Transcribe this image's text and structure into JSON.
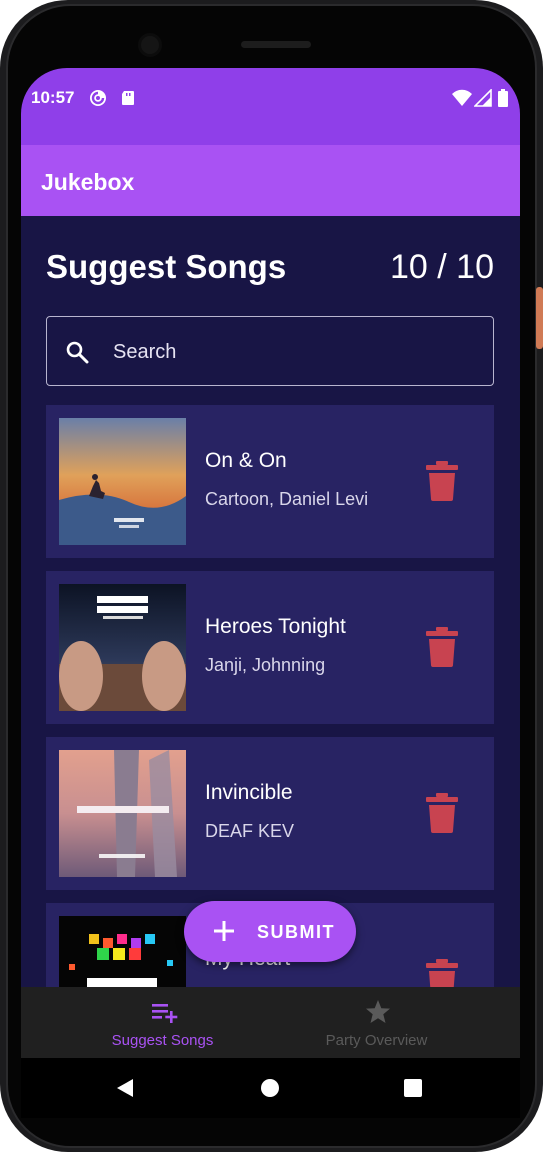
{
  "status_bar": {
    "time": "10:57",
    "icons_left": [
      "sync-icon",
      "sd-card-icon"
    ],
    "icons_right": [
      "wifi-icon",
      "signal-icon",
      "battery-icon"
    ]
  },
  "app_bar": {
    "title": "Jukebox"
  },
  "header": {
    "title": "Suggest Songs",
    "count": "10 / 10"
  },
  "search": {
    "placeholder": "Search",
    "icon": "search-icon"
  },
  "songs": [
    {
      "title": "On & On",
      "artist": "Cartoon, Daniel Levi",
      "cover_text": [
        "cartoon",
        "ON & ON"
      ],
      "action_icon": "trash-icon"
    },
    {
      "title": "Heroes Tonight",
      "artist": "Janji, Johnning",
      "cover_text": [
        "HEROES",
        "TONIGHT",
        "JANJI & JOHNNING"
      ],
      "action_icon": "trash-icon"
    },
    {
      "title": "Invincible",
      "artist": "DEAF KEV",
      "cover_text": [
        "INVINCIBLE",
        "DEAF KEV"
      ],
      "action_icon": "trash-icon"
    },
    {
      "title": "My Heart",
      "artist": "",
      "cover_text": [
        "DIFFERENT HEAVEN & EH!DE",
        "MY HEART"
      ],
      "action_icon": "trash-icon"
    }
  ],
  "fab": {
    "label": "SUBMIT",
    "icon": "plus-icon"
  },
  "bottom_nav": [
    {
      "label": "Suggest Songs",
      "icon": "playlist-add-icon",
      "active": true
    },
    {
      "label": "Party Overview",
      "icon": "star-icon",
      "active": false
    }
  ],
  "system_nav": [
    "back-icon",
    "home-icon",
    "recents-icon"
  ],
  "colors": {
    "status_bar": "#8f3fe9",
    "app_bar": "#a952f3",
    "background": "#181545",
    "card": "#282363",
    "delete": "#c84350",
    "nav_active": "#a952f3",
    "nav_inactive": "#5a5a5a"
  }
}
